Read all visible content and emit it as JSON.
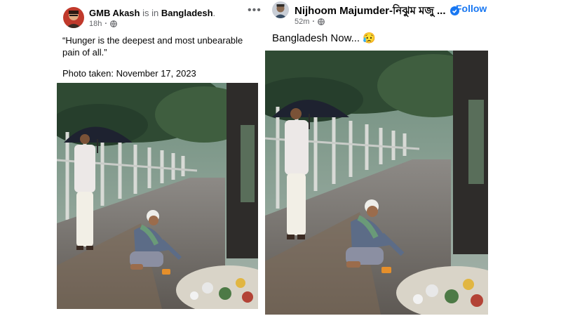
{
  "left_post": {
    "author": "GMB Akash",
    "is_in_text": "is in",
    "location": "Bangladesh",
    "location_suffix": ".",
    "time": "18h",
    "privacy_icon": "globe-icon",
    "more_icon": "more-options-icon",
    "quote": "“Hunger is the deepest and most unbearable pain of all.”",
    "photo_caption": "Photo taken: November 17, 2023"
  },
  "right_post": {
    "author": "Nijhoom Majumder-নিঝুম মজু ...",
    "verified_icon": "verified-badge-icon",
    "separator": "·",
    "follow_label": "Follow",
    "time": "52m",
    "privacy_icon": "globe-icon",
    "text": "Bangladesh Now...",
    "emoji": "😥"
  },
  "colors": {
    "facebook_blue": "#1877f2",
    "meta_gray": "#65676b",
    "text_black": "#050505"
  }
}
